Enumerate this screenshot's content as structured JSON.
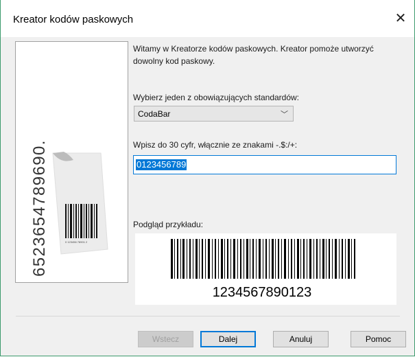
{
  "window": {
    "title": "Kreator kodów paskowych"
  },
  "side_image": {
    "digits": "6523654789690.",
    "barcode_tiny_text": "0 123456 78901 2"
  },
  "main": {
    "intro": "Witamy w Kreatorze kodów paskowych. Kreator pomoże utworzyć dowolny kod paskowy.",
    "standard_label": "Wybierz jeden z obowiązujących standardów:",
    "standard_value": "CodaBar",
    "digits_label": "Wpisz do 30 cyfr, włącznie ze znakami -.$:/+:",
    "digits_value": "0123456789",
    "preview_label": "Podgląd przykładu:",
    "preview_number": "1234567890123"
  },
  "buttons": {
    "back": "Wstecz",
    "next": "Dalej",
    "cancel": "Anuluj",
    "help": "Pomoc"
  }
}
